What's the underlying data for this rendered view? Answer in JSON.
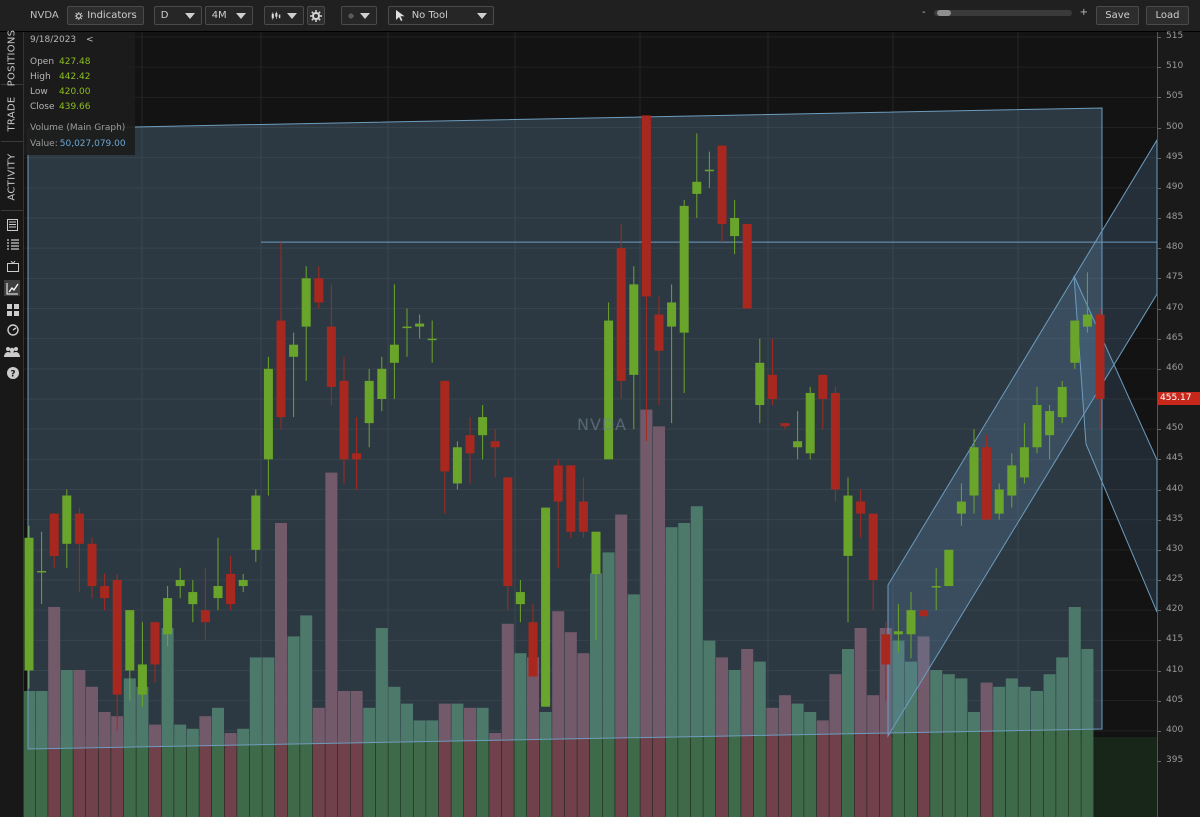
{
  "toolbar": {
    "symbol": "NVDA",
    "indicators_label": "Indicators",
    "aggregation": "D",
    "range": "4M",
    "drawing_tool": "No Tool",
    "zoom_minus": "-",
    "zoom_plus": "+",
    "save_label": "Save",
    "load_label": "Load",
    "icons": [
      "indicators-icon",
      "candle-style-icon",
      "settings-icon",
      "crosshair-icon",
      "cursor-icon"
    ]
  },
  "sidebar": {
    "tabs": [
      "POSITIONS",
      "TRADE",
      "ACTIVITY"
    ],
    "icons": [
      "news-icon",
      "list-icon",
      "tv-icon",
      "chart-icon",
      "grid-icon",
      "gauge-icon",
      "community-icon",
      "help-icon"
    ]
  },
  "info_panel": {
    "date": "9/18/2023",
    "collapse": "<",
    "open_label": "Open",
    "open": "427.48",
    "high_label": "High",
    "high": "442.42",
    "low_label": "Low",
    "low": "420.00",
    "close_label": "Close",
    "close": "439.66",
    "volume_title": "Volume (Main Graph)",
    "volume_label": "Value:",
    "volume_value": "50,027,079.00"
  },
  "chart_data": {
    "type": "candlestick",
    "symbol_watermark": "NVDA",
    "last_price": "455.17",
    "ylim": [
      392,
      517
    ],
    "y_ticks": [
      515,
      510,
      505,
      500,
      495,
      490,
      485,
      480,
      475,
      470,
      465,
      460,
      455,
      450,
      445,
      440,
      435,
      430,
      425,
      420,
      415,
      410,
      405,
      400,
      395
    ],
    "horizontal_line": 481,
    "colors": {
      "up": "#6aa52b",
      "down": "#a8281f",
      "vol_up": "#3f6a4a",
      "vol_down": "#70404b",
      "channel": "#5a88a8"
    },
    "candles": [
      {
        "o": 410,
        "h": 434,
        "l": 407,
        "c": 432
      },
      {
        "o": 426.5,
        "h": 433,
        "l": 421,
        "c": 426.5
      },
      {
        "o": 436,
        "h": 436,
        "l": 427,
        "c": 429
      },
      {
        "o": 431,
        "h": 440,
        "l": 427,
        "c": 439
      },
      {
        "o": 436,
        "h": 437,
        "l": 423,
        "c": 431
      },
      {
        "o": 431,
        "h": 432,
        "l": 422,
        "c": 424
      },
      {
        "o": 424,
        "h": 426,
        "l": 420,
        "c": 422
      },
      {
        "o": 425,
        "h": 426,
        "l": 400,
        "c": 406
      },
      {
        "o": 410,
        "h": 420,
        "l": 405,
        "c": 420
      },
      {
        "o": 406,
        "h": 418,
        "l": 404,
        "c": 411
      },
      {
        "o": 418,
        "h": 418,
        "l": 408,
        "c": 411
      },
      {
        "o": 416,
        "h": 424,
        "l": 414,
        "c": 422
      },
      {
        "o": 424,
        "h": 427,
        "l": 422,
        "c": 425
      },
      {
        "o": 421,
        "h": 425,
        "l": 418,
        "c": 423
      },
      {
        "o": 420,
        "h": 427,
        "l": 415,
        "c": 418
      },
      {
        "o": 422,
        "h": 432,
        "l": 420,
        "c": 424
      },
      {
        "o": 426,
        "h": 429,
        "l": 420,
        "c": 421
      },
      {
        "o": 424,
        "h": 426,
        "l": 423,
        "c": 425
      },
      {
        "o": 430,
        "h": 440,
        "l": 428,
        "c": 439
      },
      {
        "o": 445,
        "h": 462,
        "l": 439,
        "c": 460
      },
      {
        "o": 468,
        "h": 481,
        "l": 450,
        "c": 452
      },
      {
        "o": 462,
        "h": 466,
        "l": 452,
        "c": 464
      },
      {
        "o": 467,
        "h": 477,
        "l": 458,
        "c": 475
      },
      {
        "o": 475,
        "h": 477,
        "l": 470,
        "c": 471
      },
      {
        "o": 467,
        "h": 474,
        "l": 454,
        "c": 457
      },
      {
        "o": 458,
        "h": 462,
        "l": 441,
        "c": 445
      },
      {
        "o": 446,
        "h": 452,
        "l": 440,
        "c": 445
      },
      {
        "o": 451,
        "h": 460,
        "l": 447,
        "c": 458
      },
      {
        "o": 455,
        "h": 462,
        "l": 453,
        "c": 460
      },
      {
        "o": 461,
        "h": 474,
        "l": 455,
        "c": 464
      },
      {
        "o": 467,
        "h": 470,
        "l": 462,
        "c": 467
      },
      {
        "o": 467,
        "h": 469,
        "l": 465,
        "c": 467.5
      },
      {
        "o": 465,
        "h": 468,
        "l": 461,
        "c": 465
      },
      {
        "o": 458,
        "h": 458,
        "l": 436,
        "c": 443
      },
      {
        "o": 441,
        "h": 448,
        "l": 440,
        "c": 447
      },
      {
        "o": 449,
        "h": 452,
        "l": 441,
        "c": 446
      },
      {
        "o": 449,
        "h": 454,
        "l": 445,
        "c": 452
      },
      {
        "o": 448,
        "h": 450,
        "l": 442,
        "c": 447
      },
      {
        "o": 442,
        "h": 442,
        "l": 420,
        "c": 424
      },
      {
        "o": 421,
        "h": 425,
        "l": 418,
        "c": 423
      },
      {
        "o": 418,
        "h": 421,
        "l": 410,
        "c": 409
      },
      {
        "o": 404,
        "h": 437,
        "l": 404,
        "c": 437
      },
      {
        "o": 444,
        "h": 445,
        "l": 427,
        "c": 438
      },
      {
        "o": 444,
        "h": 444,
        "l": 432,
        "c": 433
      },
      {
        "o": 438,
        "h": 442,
        "l": 432,
        "c": 433
      },
      {
        "o": 426,
        "h": 433,
        "l": 415,
        "c": 433
      },
      {
        "o": 445,
        "h": 471,
        "l": 445,
        "c": 468
      },
      {
        "o": 480,
        "h": 484,
        "l": 455,
        "c": 458
      },
      {
        "o": 459,
        "h": 477,
        "l": 450,
        "c": 474
      },
      {
        "o": 502,
        "h": 502,
        "l": 448,
        "c": 472
      },
      {
        "o": 469,
        "h": 472,
        "l": 454,
        "c": 463
      },
      {
        "o": 467,
        "h": 474,
        "l": 451,
        "c": 471
      },
      {
        "o": 466,
        "h": 488,
        "l": 456,
        "c": 487
      },
      {
        "o": 489,
        "h": 499,
        "l": 485,
        "c": 491
      },
      {
        "o": 493,
        "h": 496,
        "l": 490,
        "c": 493
      },
      {
        "o": 497,
        "h": 497,
        "l": 481,
        "c": 484
      },
      {
        "o": 482,
        "h": 488,
        "l": 479,
        "c": 485
      },
      {
        "o": 484,
        "h": 484,
        "l": 470,
        "c": 470
      },
      {
        "o": 454,
        "h": 465,
        "l": 451,
        "c": 461
      },
      {
        "o": 459,
        "h": 465,
        "l": 454,
        "c": 455
      },
      {
        "o": 451,
        "h": 451,
        "l": 450,
        "c": 450.5
      },
      {
        "o": 447,
        "h": 453,
        "l": 445,
        "c": 448
      },
      {
        "o": 446,
        "h": 457,
        "l": 445,
        "c": 456
      },
      {
        "o": 459,
        "h": 459,
        "l": 450,
        "c": 455
      },
      {
        "o": 456,
        "h": 457,
        "l": 438,
        "c": 440
      },
      {
        "o": 429,
        "h": 442,
        "l": 418,
        "c": 439
      },
      {
        "o": 438,
        "h": 440,
        "l": 432,
        "c": 436
      },
      {
        "o": 436,
        "h": 436,
        "l": 420,
        "c": 425
      },
      {
        "o": 416,
        "h": 418,
        "l": 405,
        "c": 411
      },
      {
        "o": 416,
        "h": 421,
        "l": 413,
        "c": 416.5
      },
      {
        "o": 416,
        "h": 423,
        "l": 412,
        "c": 420
      },
      {
        "o": 420,
        "h": 422,
        "l": 418,
        "c": 419
      },
      {
        "o": 424,
        "h": 427,
        "l": 420,
        "c": 424
      },
      {
        "o": 424,
        "h": 430,
        "l": 424,
        "c": 430
      },
      {
        "o": 436,
        "h": 441,
        "l": 434,
        "c": 438
      },
      {
        "o": 439,
        "h": 450,
        "l": 436,
        "c": 447
      },
      {
        "o": 447,
        "h": 449,
        "l": 437,
        "c": 435
      },
      {
        "o": 436,
        "h": 441,
        "l": 435,
        "c": 440
      },
      {
        "o": 439,
        "h": 446,
        "l": 437,
        "c": 444
      },
      {
        "o": 442,
        "h": 451,
        "l": 441,
        "c": 447
      },
      {
        "o": 447,
        "h": 457,
        "l": 446,
        "c": 454
      },
      {
        "o": 449,
        "h": 454,
        "l": 445,
        "c": 453
      },
      {
        "o": 452,
        "h": 458,
        "l": 451,
        "c": 457
      },
      {
        "o": 461,
        "h": 467,
        "l": 460,
        "c": 468
      },
      {
        "o": 467,
        "h": 476,
        "l": 466,
        "c": 469
      },
      {
        "o": 469,
        "h": 470,
        "l": 450,
        "c": 455
      }
    ],
    "volume_norm": [
      0.3,
      0.3,
      0.5,
      0.35,
      0.35,
      0.31,
      0.25,
      0.24,
      0.33,
      0.31,
      0.22,
      0.45,
      0.22,
      0.21,
      0.24,
      0.26,
      0.2,
      0.21,
      0.38,
      0.38,
      0.7,
      0.43,
      0.48,
      0.26,
      0.82,
      0.3,
      0.3,
      0.26,
      0.45,
      0.31,
      0.27,
      0.23,
      0.23,
      0.27,
      0.27,
      0.26,
      0.26,
      0.2,
      0.46,
      0.39,
      0.38,
      0.25,
      0.49,
      0.44,
      0.39,
      0.58,
      0.63,
      0.72,
      0.53,
      0.97,
      0.93,
      0.69,
      0.7,
      0.74,
      0.42,
      0.38,
      0.35,
      0.4,
      0.37,
      0.26,
      0.29,
      0.27,
      0.25,
      0.23,
      0.34,
      0.4,
      0.45,
      0.29,
      0.45,
      0.42,
      0.37,
      0.43,
      0.35,
      0.34,
      0.33,
      0.25,
      0.32,
      0.31,
      0.33,
      0.31,
      0.3,
      0.34,
      0.38,
      0.5,
      0.4
    ]
  }
}
